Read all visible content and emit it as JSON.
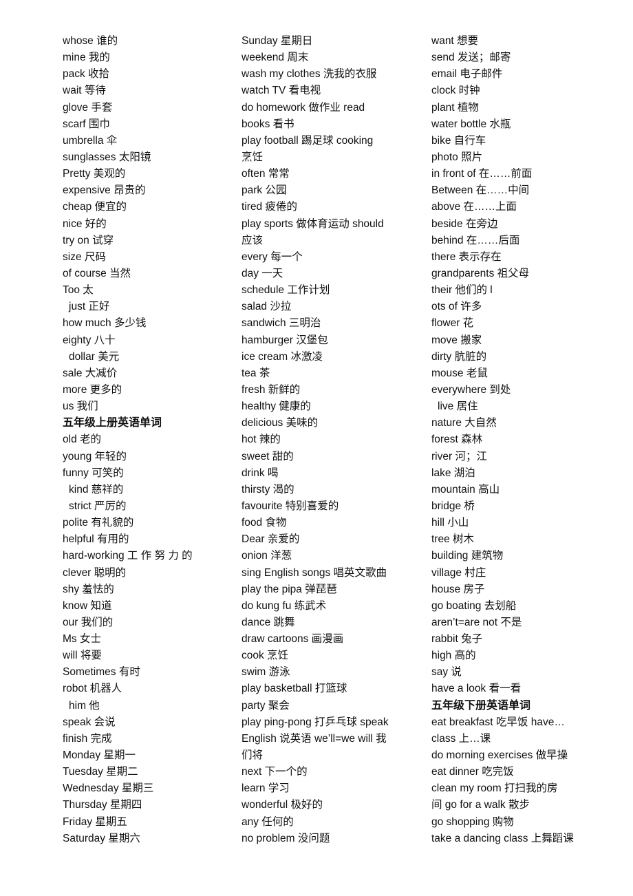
{
  "columns": [
    {
      "lines": [
        "whose 谁的",
        "mine  我的",
        "pack  收拾",
        "wait  等待",
        "glove  手套",
        "scarf  围巾",
        "umbrella  伞",
        "sunglasses  太阳镜",
        "Pretty 美观的",
        "expensive 昂贵的",
        "cheap 便宜的",
        "nice 好的",
        "try on 试穿",
        "size 尺码",
        "of course 当然",
        "Too 太",
        "just 正好",
        "how much 多少钱",
        "eighty 八十",
        "dollar 美元",
        "sale 大减价",
        "more 更多的",
        "us 我们",
        "五年级上册英语单词",
        "old 老的",
        "young 年轻的",
        "funny 可笑的",
        "kind 慈祥的",
        "strict 严厉的",
        "polite 有礼貌的",
        "helpful 有用的",
        "hard-working  工 作 努 力 的",
        "clever 聪明的",
        "shy 羞怯的",
        "know 知道",
        "our 我们的",
        "Ms 女士",
        "will 将要",
        "Sometimes 有时",
        "robot 机器人",
        "him 他",
        "speak 会说",
        "finish 完成",
        "Monday 星期一",
        "Tuesday 星期二",
        "Wednesday  星期三",
        "Thursday  星期四",
        "Friday  星期五",
        "Saturday  星期六"
      ]
    },
    {
      "lines": [
        "Sunday  星期日",
        "weekend  周末",
        "wash my clothes  洗我的衣服",
        "watch TV 看电视",
        "do homework  做作业        read",
        "books  看书",
        "play football  踢足球    cooking",
        "烹饪",
        "often  常常",
        "park  公园",
        "tired 疲倦的",
        "play sports  做体育运动  should",
        "应该",
        "every  每一个",
        "day 一天",
        "schedule 工作计划",
        "salad  沙拉",
        "sandwich 三明治",
        "hamburger 汉堡包",
        "ice cream 冰激凌",
        "tea 茶",
        "fresh 新鲜的",
        "healthy 健康的",
        "delicious 美味的",
        "hot 辣的",
        "sweet 甜的",
        "drink  喝",
        "thirsty 渴的",
        "favourite  特别喜爱的",
        "food  食物",
        "Dear 亲爱的",
        "onion 洋葱",
        "sing English songs 唱英文歌曲",
        "play the pipa  弹琵琶",
        "do kung fu 练武术",
        "dance 跳舞",
        "draw cartoons 画漫画",
        "cook 烹饪",
        "swim  游泳",
        "play basketball 打篮球",
        "party 聚会",
        "play ping-pong 打乒乓球  speak",
        "English 说英语  we’ll=we will 我",
        "们将",
        "next 下一个的",
        "learn 学习",
        "wonderful 极好的",
        "any 任何的",
        "no problem 没问题"
      ]
    },
    {
      "lines": [
        "want 想要",
        "send 发送；邮寄",
        "email 电子邮件",
        "clock  时钟",
        "plant  植物",
        "water bottle 水瓶",
        "bike 自行车",
        "photo 照片",
        "in front of 在……前面",
        "Between 在……中间",
        "above 在……上面",
        "beside 在旁边",
        "behind 在……后面",
        "there 表示存在",
        "grandparents 祖父母",
        "their 他们的  l",
        "ots of 许多",
        "flower 花",
        "move 搬家",
        "dirty 肮脏的",
        "mouse 老鼠",
        "everywhere  到处",
        "live 居住",
        "nature 大自然",
        "forest 森林",
        "river 河；江",
        "lake 湖泊",
        "mountain 高山",
        "bridge 桥",
        "hill 小山",
        "tree 树木",
        "building 建筑物",
        "village 村庄",
        "house 房子",
        "go boating 去划船",
        "aren’t=are not 不是",
        "rabbit 兔子",
        "high 高的",
        "say 说",
        "have a look 看一看",
        "五年级下册英语单词",
        "eat breakfast  吃早饭    have…",
        "class  上…课",
        "do morning exercises  做早操",
        "eat dinner  吃完饭",
        "clean my room 打扫我的房",
        "间  go for a walk 散步",
        "go shopping 购物",
        "take a dancing class 上舞蹈课"
      ]
    }
  ]
}
